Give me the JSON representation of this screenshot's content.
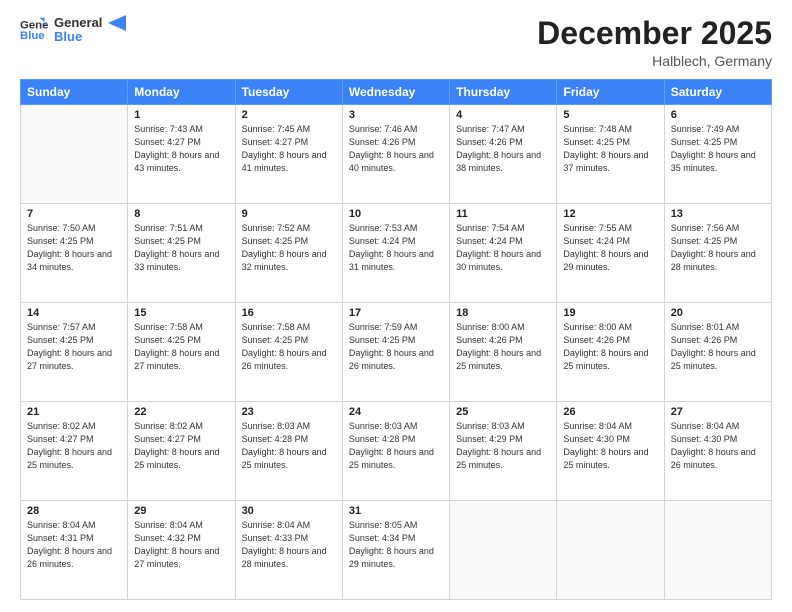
{
  "logo": {
    "line1": "General",
    "line2": "Blue"
  },
  "title": "December 2025",
  "location": "Halblech, Germany",
  "weekdays": [
    "Sunday",
    "Monday",
    "Tuesday",
    "Wednesday",
    "Thursday",
    "Friday",
    "Saturday"
  ],
  "weeks": [
    [
      {
        "day": "",
        "sunrise": "",
        "sunset": "",
        "daylight": ""
      },
      {
        "day": "1",
        "sunrise": "Sunrise: 7:43 AM",
        "sunset": "Sunset: 4:27 PM",
        "daylight": "Daylight: 8 hours and 43 minutes."
      },
      {
        "day": "2",
        "sunrise": "Sunrise: 7:45 AM",
        "sunset": "Sunset: 4:27 PM",
        "daylight": "Daylight: 8 hours and 41 minutes."
      },
      {
        "day": "3",
        "sunrise": "Sunrise: 7:46 AM",
        "sunset": "Sunset: 4:26 PM",
        "daylight": "Daylight: 8 hours and 40 minutes."
      },
      {
        "day": "4",
        "sunrise": "Sunrise: 7:47 AM",
        "sunset": "Sunset: 4:26 PM",
        "daylight": "Daylight: 8 hours and 38 minutes."
      },
      {
        "day": "5",
        "sunrise": "Sunrise: 7:48 AM",
        "sunset": "Sunset: 4:25 PM",
        "daylight": "Daylight: 8 hours and 37 minutes."
      },
      {
        "day": "6",
        "sunrise": "Sunrise: 7:49 AM",
        "sunset": "Sunset: 4:25 PM",
        "daylight": "Daylight: 8 hours and 35 minutes."
      }
    ],
    [
      {
        "day": "7",
        "sunrise": "Sunrise: 7:50 AM",
        "sunset": "Sunset: 4:25 PM",
        "daylight": "Daylight: 8 hours and 34 minutes."
      },
      {
        "day": "8",
        "sunrise": "Sunrise: 7:51 AM",
        "sunset": "Sunset: 4:25 PM",
        "daylight": "Daylight: 8 hours and 33 minutes."
      },
      {
        "day": "9",
        "sunrise": "Sunrise: 7:52 AM",
        "sunset": "Sunset: 4:25 PM",
        "daylight": "Daylight: 8 hours and 32 minutes."
      },
      {
        "day": "10",
        "sunrise": "Sunrise: 7:53 AM",
        "sunset": "Sunset: 4:24 PM",
        "daylight": "Daylight: 8 hours and 31 minutes."
      },
      {
        "day": "11",
        "sunrise": "Sunrise: 7:54 AM",
        "sunset": "Sunset: 4:24 PM",
        "daylight": "Daylight: 8 hours and 30 minutes."
      },
      {
        "day": "12",
        "sunrise": "Sunrise: 7:55 AM",
        "sunset": "Sunset: 4:24 PM",
        "daylight": "Daylight: 8 hours and 29 minutes."
      },
      {
        "day": "13",
        "sunrise": "Sunrise: 7:56 AM",
        "sunset": "Sunset: 4:25 PM",
        "daylight": "Daylight: 8 hours and 28 minutes."
      }
    ],
    [
      {
        "day": "14",
        "sunrise": "Sunrise: 7:57 AM",
        "sunset": "Sunset: 4:25 PM",
        "daylight": "Daylight: 8 hours and 27 minutes."
      },
      {
        "day": "15",
        "sunrise": "Sunrise: 7:58 AM",
        "sunset": "Sunset: 4:25 PM",
        "daylight": "Daylight: 8 hours and 27 minutes."
      },
      {
        "day": "16",
        "sunrise": "Sunrise: 7:58 AM",
        "sunset": "Sunset: 4:25 PM",
        "daylight": "Daylight: 8 hours and 26 minutes."
      },
      {
        "day": "17",
        "sunrise": "Sunrise: 7:59 AM",
        "sunset": "Sunset: 4:25 PM",
        "daylight": "Daylight: 8 hours and 26 minutes."
      },
      {
        "day": "18",
        "sunrise": "Sunrise: 8:00 AM",
        "sunset": "Sunset: 4:26 PM",
        "daylight": "Daylight: 8 hours and 25 minutes."
      },
      {
        "day": "19",
        "sunrise": "Sunrise: 8:00 AM",
        "sunset": "Sunset: 4:26 PM",
        "daylight": "Daylight: 8 hours and 25 minutes."
      },
      {
        "day": "20",
        "sunrise": "Sunrise: 8:01 AM",
        "sunset": "Sunset: 4:26 PM",
        "daylight": "Daylight: 8 hours and 25 minutes."
      }
    ],
    [
      {
        "day": "21",
        "sunrise": "Sunrise: 8:02 AM",
        "sunset": "Sunset: 4:27 PM",
        "daylight": "Daylight: 8 hours and 25 minutes."
      },
      {
        "day": "22",
        "sunrise": "Sunrise: 8:02 AM",
        "sunset": "Sunset: 4:27 PM",
        "daylight": "Daylight: 8 hours and 25 minutes."
      },
      {
        "day": "23",
        "sunrise": "Sunrise: 8:03 AM",
        "sunset": "Sunset: 4:28 PM",
        "daylight": "Daylight: 8 hours and 25 minutes."
      },
      {
        "day": "24",
        "sunrise": "Sunrise: 8:03 AM",
        "sunset": "Sunset: 4:28 PM",
        "daylight": "Daylight: 8 hours and 25 minutes."
      },
      {
        "day": "25",
        "sunrise": "Sunrise: 8:03 AM",
        "sunset": "Sunset: 4:29 PM",
        "daylight": "Daylight: 8 hours and 25 minutes."
      },
      {
        "day": "26",
        "sunrise": "Sunrise: 8:04 AM",
        "sunset": "Sunset: 4:30 PM",
        "daylight": "Daylight: 8 hours and 25 minutes."
      },
      {
        "day": "27",
        "sunrise": "Sunrise: 8:04 AM",
        "sunset": "Sunset: 4:30 PM",
        "daylight": "Daylight: 8 hours and 26 minutes."
      }
    ],
    [
      {
        "day": "28",
        "sunrise": "Sunrise: 8:04 AM",
        "sunset": "Sunset: 4:31 PM",
        "daylight": "Daylight: 8 hours and 26 minutes."
      },
      {
        "day": "29",
        "sunrise": "Sunrise: 8:04 AM",
        "sunset": "Sunset: 4:32 PM",
        "daylight": "Daylight: 8 hours and 27 minutes."
      },
      {
        "day": "30",
        "sunrise": "Sunrise: 8:04 AM",
        "sunset": "Sunset: 4:33 PM",
        "daylight": "Daylight: 8 hours and 28 minutes."
      },
      {
        "day": "31",
        "sunrise": "Sunrise: 8:05 AM",
        "sunset": "Sunset: 4:34 PM",
        "daylight": "Daylight: 8 hours and 29 minutes."
      },
      {
        "day": "",
        "sunrise": "",
        "sunset": "",
        "daylight": ""
      },
      {
        "day": "",
        "sunrise": "",
        "sunset": "",
        "daylight": ""
      },
      {
        "day": "",
        "sunrise": "",
        "sunset": "",
        "daylight": ""
      }
    ]
  ]
}
